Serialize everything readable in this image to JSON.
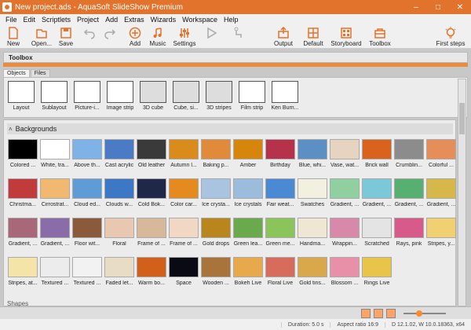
{
  "window": {
    "title": "New project.ads - AquaSoft SlideShow Premium"
  },
  "menu": [
    "File",
    "Edit",
    "Scriptlets",
    "Project",
    "Add",
    "Extras",
    "Wizards",
    "Workspace",
    "Help"
  ],
  "toolbar": {
    "new": "New",
    "open": "Open...",
    "save": "Save",
    "add": "Add",
    "music": "Music",
    "settings": "Settings",
    "output": "Output",
    "default": "Default",
    "storyboard": "Storyboard",
    "toolbox": "Toolbox",
    "first_steps": "First steps"
  },
  "toolbox": {
    "title": "Toolbox",
    "tabs": [
      "Objects",
      "Files"
    ]
  },
  "objects": [
    "Layout",
    "Sublayout",
    "Picture-i...",
    "Image strip",
    "3D cube",
    "Cube, si...",
    "3D stripes",
    "Film strip",
    "Ken Burn..."
  ],
  "gallery": {
    "section": "Backgrounds",
    "next_section": "Shapes",
    "rows": [
      [
        "Colored ...",
        "White, tra...",
        "Above th...",
        "Cast acrylic",
        "Old leather",
        "Autumn l...",
        "Baking p...",
        "Amber",
        "Birthday",
        "Blue, whi...",
        "Vase, wat...",
        "Brick wall",
        "Crumblin...",
        "Colorful ..."
      ],
      [
        "Christma...",
        "Cirrostrat...",
        "Cloud ed...",
        "Clouds w...",
        "Cold Bok...",
        "Color car...",
        "Ice crysta...",
        "Ice crystals",
        "Fair weat...",
        "Swatches",
        "Gradient, ...",
        "Gradient, ...",
        "Gradient, ...",
        "Gradient, ..."
      ],
      [
        "Gradient, ...",
        "Gradient, ...",
        "Floor wit...",
        "Floral",
        "Frame of ...",
        "Frame of ...",
        "Gold drops",
        "Green lea...",
        "Green me...",
        "Handma...",
        "Wrappin...",
        "Scratched",
        "Rays, pink",
        "Stripes, y..."
      ],
      [
        "Stripes, at...",
        "Textured ...",
        "Textured ...",
        "Faded let...",
        "Warm bo...",
        "Space",
        "Wooden ...",
        "Bokeh Live",
        "Floral Live",
        "Gold tins...",
        "Blossom ...",
        "Rings Live"
      ]
    ]
  },
  "status": {
    "duration": "Duration: 5.0 s",
    "aspect": "Aspect ratio 16:9",
    "version": "D 12.1.02, W 10.0.18363, x64"
  }
}
